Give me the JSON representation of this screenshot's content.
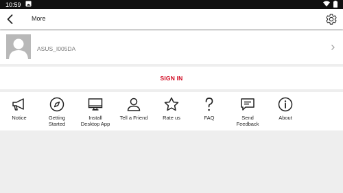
{
  "status_bar": {
    "time": "10:59",
    "icons": [
      "image-icon",
      "wifi-icon",
      "battery-icon"
    ]
  },
  "app_bar": {
    "title": "More",
    "back_icon": "back-arrow-icon",
    "settings_icon": "gear-icon"
  },
  "profile": {
    "username": "ASUS_I005DA",
    "avatar_icon": "person-silhouette-icon",
    "chevron_icon": "chevron-right-icon"
  },
  "signin": {
    "label": "SIGN IN",
    "color": "#d0021b"
  },
  "menu": [
    {
      "line1": "Notice",
      "line2": "",
      "icon": "megaphone-icon"
    },
    {
      "line1": "Getting",
      "line2": "Started",
      "icon": "compass-icon"
    },
    {
      "line1": "Install",
      "line2": "Desktop App",
      "icon": "monitor-icon"
    },
    {
      "line1": "Tell a Friend",
      "line2": "",
      "icon": "person-icon"
    },
    {
      "line1": "Rate us",
      "line2": "",
      "icon": "star-icon"
    },
    {
      "line1": "FAQ",
      "line2": "",
      "icon": "question-icon"
    },
    {
      "line1": "Send",
      "line2": "Feedback",
      "icon": "feedback-icon"
    },
    {
      "line1": "About",
      "line2": "",
      "icon": "info-icon"
    }
  ]
}
